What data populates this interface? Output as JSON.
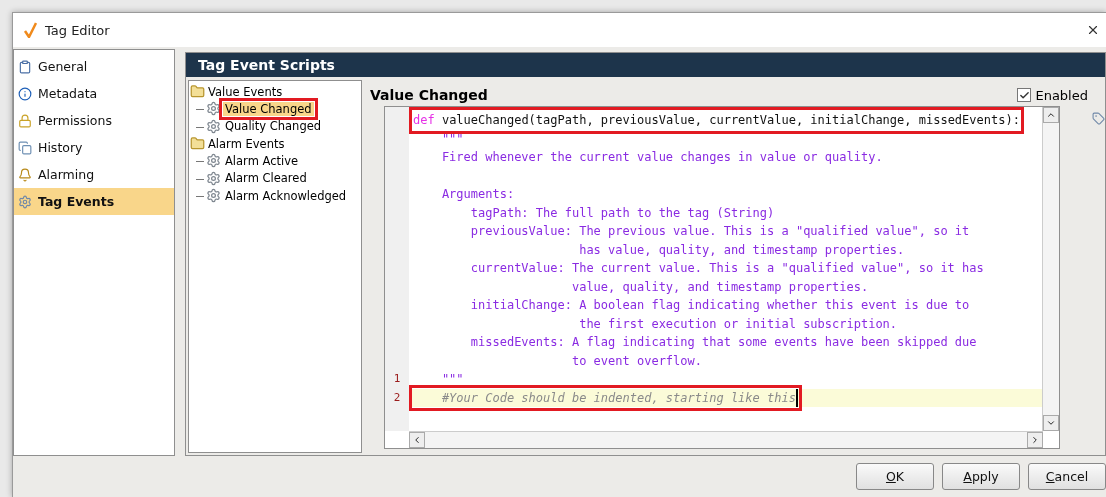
{
  "window": {
    "title": "Tag Editor"
  },
  "sidebar": {
    "items": [
      {
        "label": "General",
        "selected": false
      },
      {
        "label": "Metadata",
        "selected": false
      },
      {
        "label": "Permissions",
        "selected": false
      },
      {
        "label": "History",
        "selected": false
      },
      {
        "label": "Alarming",
        "selected": false
      },
      {
        "label": "Tag Events",
        "selected": true
      }
    ]
  },
  "panel": {
    "title": "Tag Event Scripts"
  },
  "tree": [
    {
      "label": "Value Events",
      "expanded": true,
      "children": [
        {
          "label": "Value Changed",
          "selected": true,
          "highlighted": true
        },
        {
          "label": "Quality Changed",
          "selected": false,
          "highlighted": false
        }
      ]
    },
    {
      "label": "Alarm Events",
      "expanded": true,
      "children": [
        {
          "label": "Alarm Active",
          "selected": false,
          "highlighted": false
        },
        {
          "label": "Alarm Cleared",
          "selected": false,
          "highlighted": false
        },
        {
          "label": "Alarm Acknowledged",
          "selected": false,
          "highlighted": false
        }
      ]
    }
  ],
  "editor": {
    "title": "Value Changed",
    "enabled": {
      "label": "Enabled",
      "checked": true
    },
    "lines": [
      {
        "kind": "signature",
        "keyword": "def",
        "text": "valueChanged(tagPath, previousValue, currentValue, initialChange, missedEvents):",
        "highlighted": true,
        "current": false
      },
      {
        "kind": "docstring",
        "text": "    \"\"\"",
        "current": false
      },
      {
        "kind": "docstring",
        "text": "    Fired whenever the current value changes in value or quality.",
        "current": false
      },
      {
        "kind": "blank",
        "current": false
      },
      {
        "kind": "docstring",
        "text": "    Arguments:",
        "current": false
      },
      {
        "kind": "docstring",
        "text": "        tagPath: The full path to the tag (String)",
        "current": false
      },
      {
        "kind": "docstring",
        "text": "        previousValue: The previous value. This is a \"qualified value\", so it",
        "current": false
      },
      {
        "kind": "docstring",
        "text": "                       has value, quality, and timestamp properties.",
        "current": false
      },
      {
        "kind": "docstring",
        "text": "        currentValue: The current value. This is a \"qualified value\", so it has",
        "current": false
      },
      {
        "kind": "docstring",
        "text": "                      value, quality, and timestamp properties.",
        "current": false
      },
      {
        "kind": "docstring",
        "text": "        initialChange: A boolean flag indicating whether this event is due to",
        "current": false
      },
      {
        "kind": "docstring",
        "text": "                       the first execution or initial subscription.",
        "current": false
      },
      {
        "kind": "docstring",
        "text": "        missedEvents: A flag indicating that some events have been skipped due",
        "current": false
      },
      {
        "kind": "docstring",
        "text": "                      to event overflow.",
        "current": false
      },
      {
        "kind": "docstring",
        "number": "1",
        "text": "    \"\"\"",
        "current": false
      },
      {
        "kind": "comment",
        "number": "2",
        "text": "    #Your Code should be indented, starting like this",
        "highlighted": true,
        "current": true
      }
    ]
  },
  "buttons": [
    {
      "label": "OK"
    },
    {
      "label": "Apply"
    },
    {
      "label": "Cancel"
    }
  ]
}
